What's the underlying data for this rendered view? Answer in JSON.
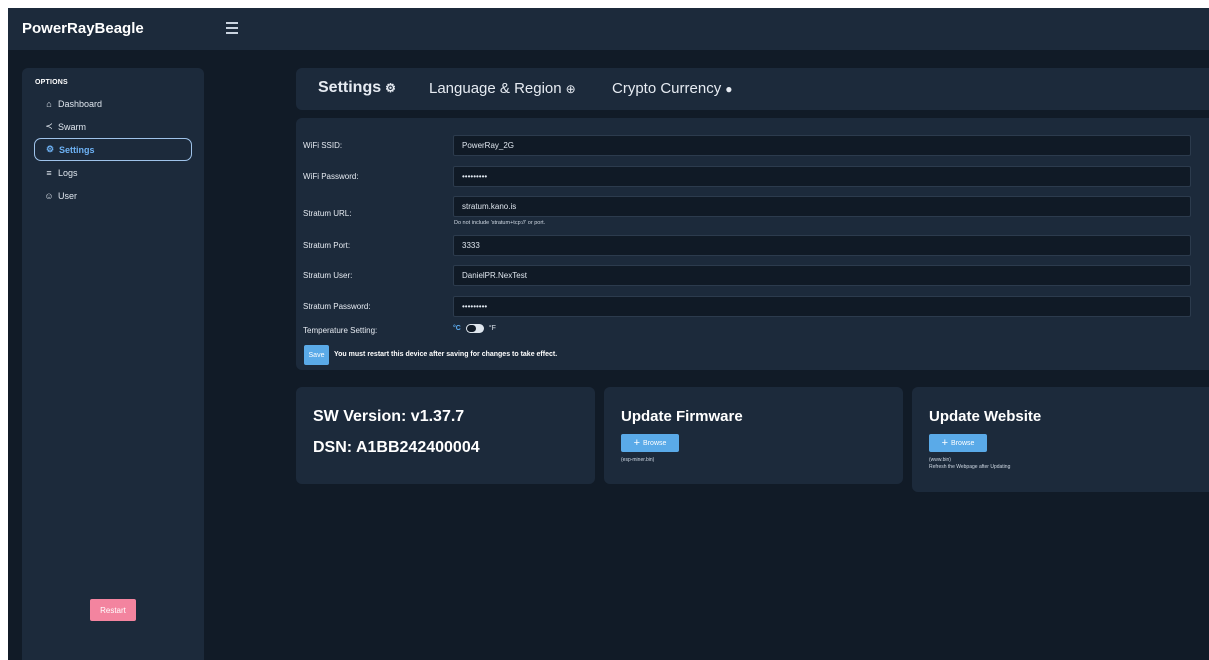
{
  "app": {
    "title": "PowerRayBeagle"
  },
  "sidebar": {
    "section_title": "OPTIONS",
    "items": [
      {
        "label": "Dashboard",
        "icon": "home-icon",
        "glyph": "⌂"
      },
      {
        "label": "Swarm",
        "icon": "share-icon",
        "glyph": "≺"
      },
      {
        "label": "Settings",
        "icon": "gear-icon",
        "glyph": "⚙",
        "active": true
      },
      {
        "label": "Logs",
        "icon": "list-icon",
        "glyph": "≡"
      },
      {
        "label": "User",
        "icon": "user-icon",
        "glyph": "☺"
      }
    ],
    "restart_label": "Restart"
  },
  "tabs": [
    {
      "label": "Settings",
      "icon": "gear-icon",
      "glyph": "⚙",
      "active": true
    },
    {
      "label": "Language & Region",
      "icon": "globe-icon",
      "glyph": "⊕"
    },
    {
      "label": "Crypto Currency",
      "icon": "bitcoin-icon",
      "glyph": "●"
    }
  ],
  "form": {
    "wifi_ssid": {
      "label": "WiFi SSID:",
      "value": "PowerRay_2G"
    },
    "wifi_password": {
      "label": "WiFi Password:",
      "value": "•••••••••"
    },
    "stratum_url": {
      "label": "Stratum URL:",
      "value": "stratum.kano.is",
      "hint": "Do not include 'stratum+tcp://' or port."
    },
    "stratum_port": {
      "label": "Stratum Port:",
      "value": "3333"
    },
    "stratum_user": {
      "label": "Stratum User:",
      "value": "DanielPR.NexTest"
    },
    "stratum_password": {
      "label": "Stratum Password:",
      "value": "•••••••••"
    },
    "temperature": {
      "label": "Temperature Setting:",
      "celsius": "°C",
      "fahrenheit": "°F",
      "selected": "°C"
    },
    "save_label": "Save",
    "save_note": "You must restart this device after saving for changes to take effect."
  },
  "info": {
    "sw_version": "SW Version: v1.37.7",
    "dsn": "DSN: A1BB242400004"
  },
  "firmware": {
    "title": "Update Firmware",
    "browse_label": "Browse",
    "file_hint": "(esp-miner.bin)"
  },
  "website": {
    "title": "Update Website",
    "browse_label": "Browse",
    "file_hint": "(www.bin)",
    "note": "Refresh the Webpage after Updating"
  },
  "colors": {
    "background": "#111b27",
    "panel": "#1c2a3b",
    "accent": "#5aaae8",
    "restart": "#f3849f",
    "active_nav": "#6db2f5"
  }
}
